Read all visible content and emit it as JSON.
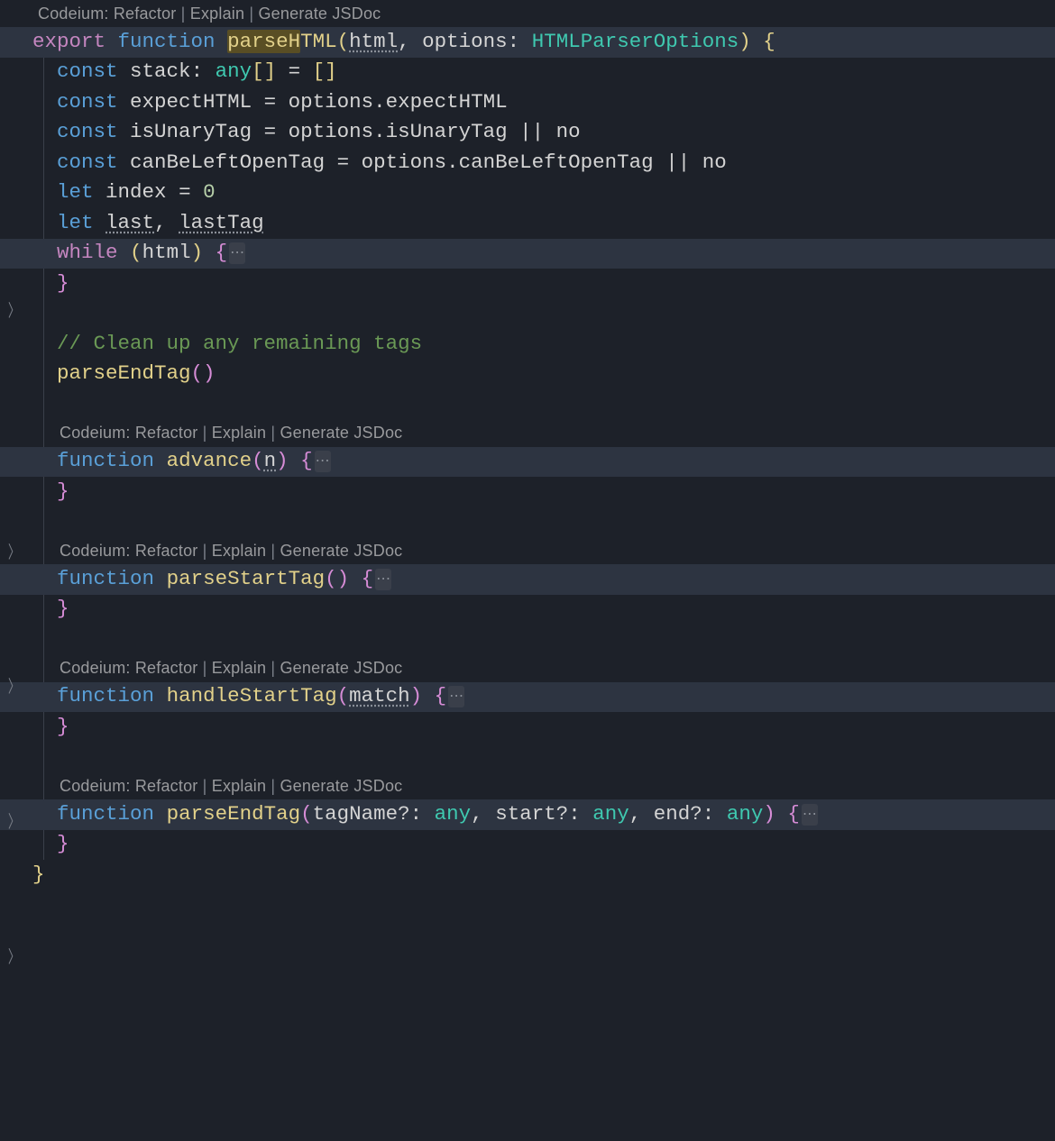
{
  "codelens": {
    "prefix": "Codeium: ",
    "refactor": "Refactor",
    "explain": "Explain",
    "jsdoc": "Generate JSDoc",
    "sep": " | "
  },
  "func": {
    "export_kw": "export",
    "function_kw": "function",
    "name_pre": "parseH",
    "name_post": "TML",
    "open_paren": "(",
    "param_html": "html",
    "comma": ", ",
    "param_options": "options",
    "colon": ": ",
    "type_options": "HTMLParserOptions",
    "close_paren": ")",
    "open_brace": " {"
  },
  "body": {
    "const_kw": "const",
    "let_kw": "let",
    "stack": "stack",
    "stack_type": "any",
    "brack_open": "[",
    "brack_close": "]",
    "eq": " = ",
    "empty_open": "[",
    "empty_close": "]",
    "expectHTML_var": "expectHTML",
    "options": "options",
    "dot": ".",
    "expectHTML_prop": "expectHTML",
    "isUnaryTag_var": "isUnaryTag",
    "isUnaryTag_prop": "isUnaryTag",
    "oror": " || ",
    "no": "no",
    "canBeLeftOpenTag_var": "canBeLeftOpenTag",
    "canBeLeftOpenTag_prop": "canBeLeftOpenTag",
    "index_var": "index",
    "zero": "0",
    "last_var": "last",
    "lastTag_var": "lastTag",
    "while_kw": "while",
    "html_ref": "html",
    "close_brace": "}",
    "comment": "// Clean up any remaining tags",
    "parseEndTag_call": "parseEndTag",
    "parens": "()"
  },
  "inner": {
    "function_kw": "function",
    "advance": "advance",
    "advance_param": "n",
    "parseStartTag": "parseStartTag",
    "handleStartTag": "handleStartTag",
    "handle_param": "match",
    "parseEndTag": "parseEndTag",
    "tagName": "tagName",
    "start": "start",
    "end": "end",
    "opt": "?",
    "colon": ": ",
    "any": "any",
    "open_paren": "(",
    "close_paren": ")",
    "open_brace": " {",
    "close_brace": "}",
    "comma": ", "
  },
  "ellipsis": "⋯"
}
